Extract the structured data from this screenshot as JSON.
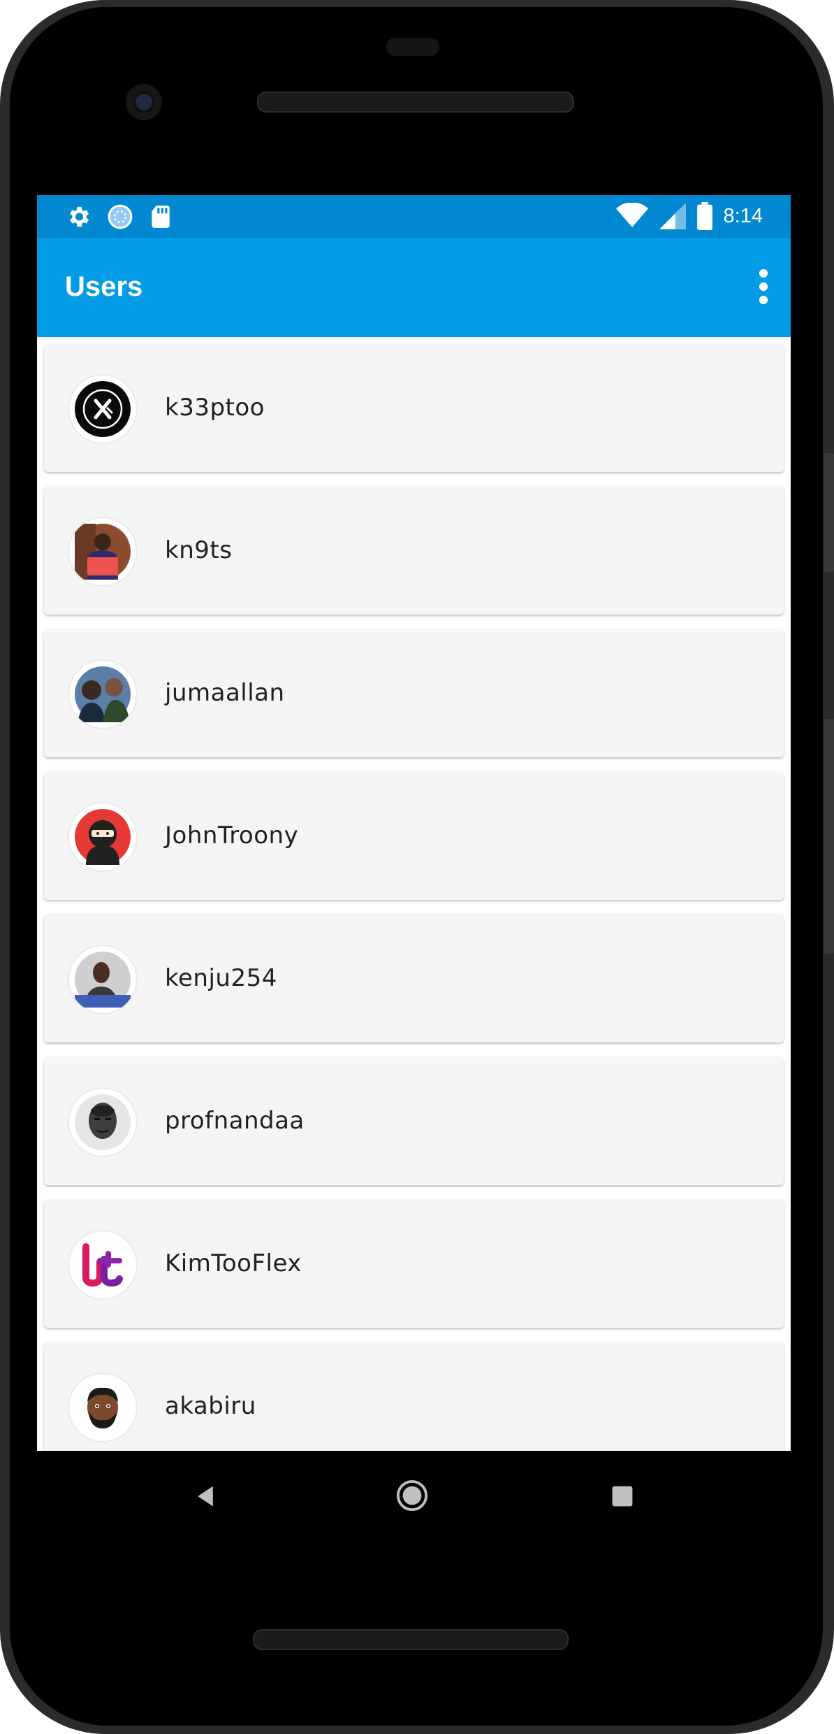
{
  "status_bar": {
    "time": "8:14",
    "left_icons": [
      "gear-icon",
      "sync-circle-icon",
      "sd-card-icon"
    ],
    "right_icons": [
      "wifi-icon",
      "signal-icon",
      "battery-icon"
    ]
  },
  "app_bar": {
    "title": "Users",
    "overflow_icon": "more-vert-icon",
    "color": "#039be5",
    "status_color": "#0288d1"
  },
  "users": [
    {
      "username": "k33ptoo",
      "avatar_icon": "k33ptoo-avatar"
    },
    {
      "username": "kn9ts",
      "avatar_icon": "kn9ts-avatar"
    },
    {
      "username": "jumaallan",
      "avatar_icon": "jumaallan-avatar"
    },
    {
      "username": "JohnTroony",
      "avatar_icon": "ninja-avatar"
    },
    {
      "username": "kenju254",
      "avatar_icon": "kenju254-avatar"
    },
    {
      "username": "profnandaa",
      "avatar_icon": "profnandaa-avatar"
    },
    {
      "username": "KimTooFlex",
      "avatar_icon": "kimtooflex-logo-avatar"
    },
    {
      "username": "akabiru",
      "avatar_icon": "akabiru-avatar"
    }
  ],
  "nav_bar": {
    "back_icon": "back-triangle-icon",
    "home_icon": "home-circle-icon",
    "recent_icon": "recent-square-icon"
  }
}
